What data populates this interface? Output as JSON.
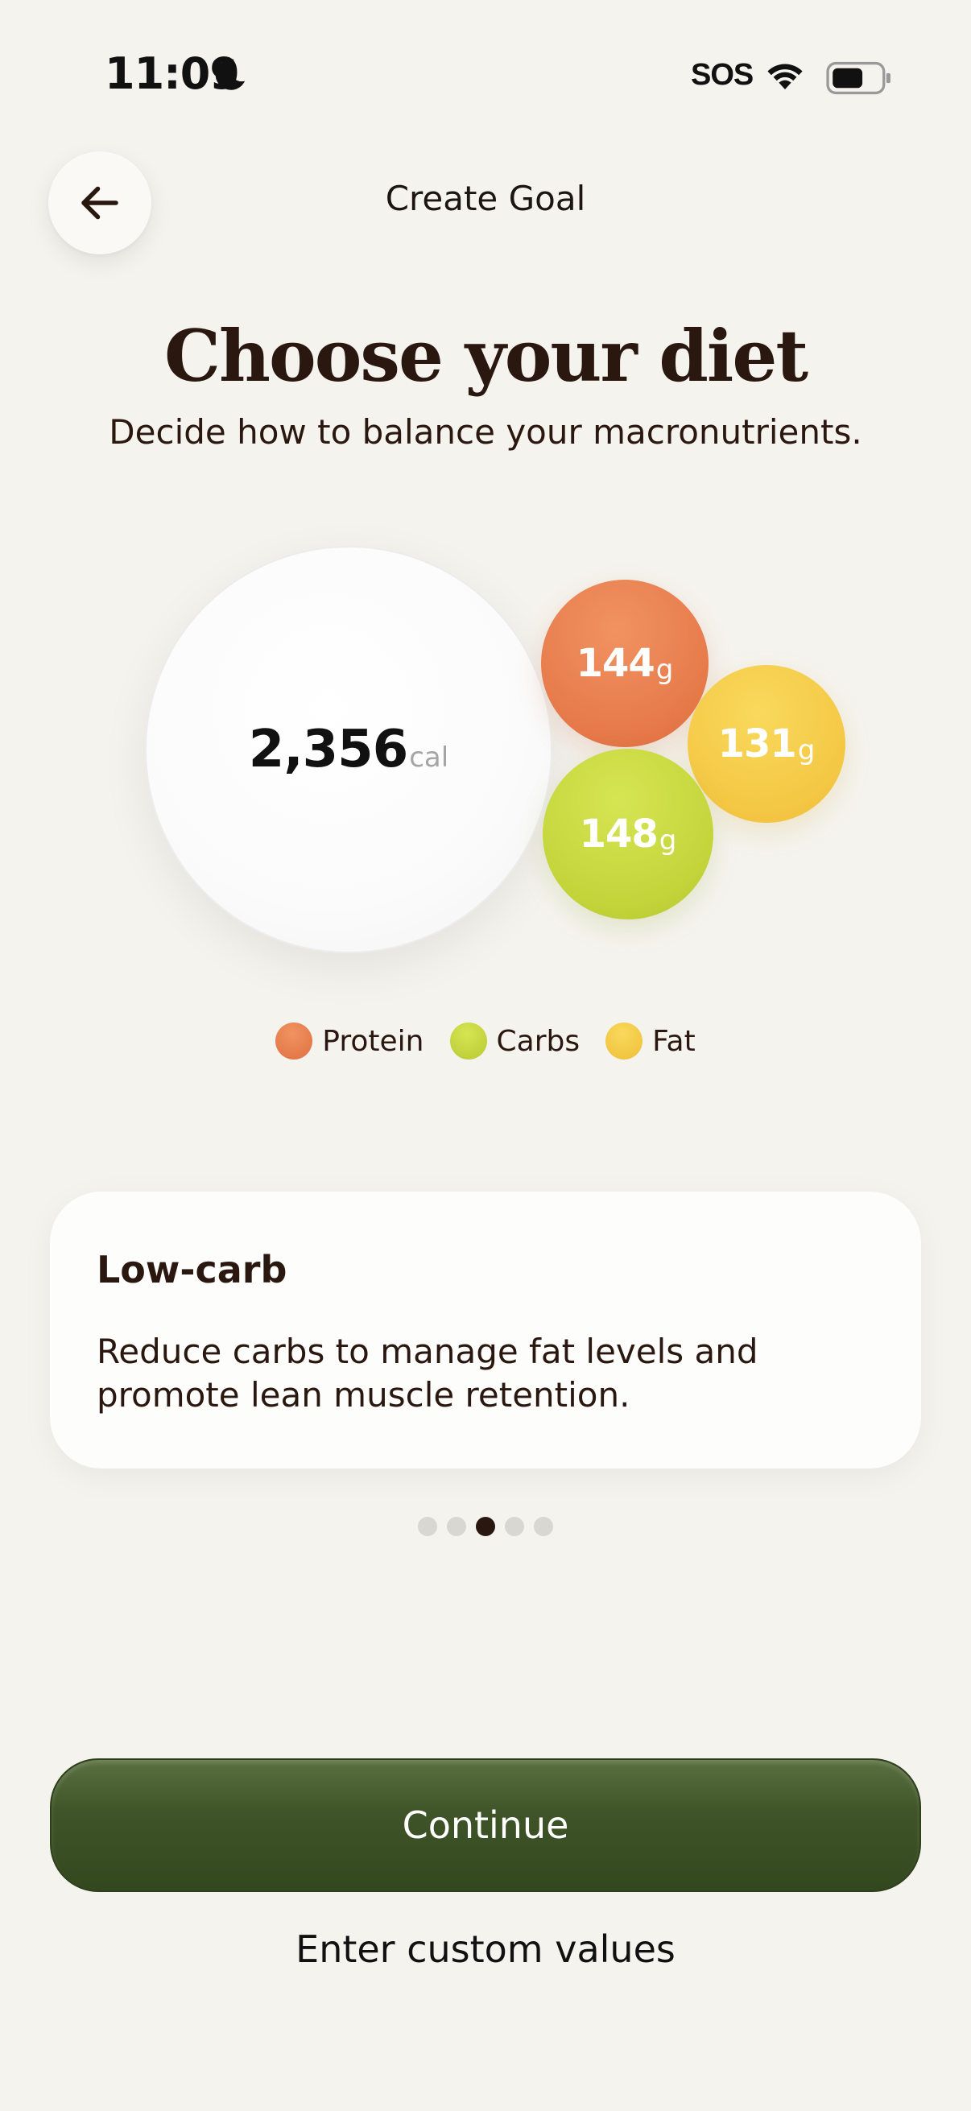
{
  "status_bar": {
    "time": "11:09",
    "sos": "SOS",
    "icons": [
      "moon-icon",
      "wifi-icon",
      "battery-icon"
    ]
  },
  "header": {
    "title": "Create Goal",
    "back_icon": "arrow-left-icon"
  },
  "main": {
    "title": "Choose your diet",
    "subtitle": "Decide how to balance your macronutrients."
  },
  "macros": {
    "calories": {
      "value": "2,356",
      "unit": "cal"
    },
    "protein": {
      "value": "144",
      "unit": "g",
      "color": "#e6794a"
    },
    "carbs": {
      "value": "148",
      "unit": "g",
      "color": "#c3d43a"
    },
    "fat": {
      "value": "131",
      "unit": "g",
      "color": "#f4c744"
    }
  },
  "legend": {
    "protein": "Protein",
    "carbs": "Carbs",
    "fat": "Fat"
  },
  "diet_card": {
    "title": "Low-carb",
    "description_line1": "Reduce carbs to manage fat levels and",
    "description_line2": "promote lean muscle retention."
  },
  "pager": {
    "count": 5,
    "active_index": 3
  },
  "actions": {
    "continue_label": "Continue",
    "custom_label": "Enter custom values"
  },
  "colors": {
    "background": "#f5f3ee",
    "primary_button": "#3f5428",
    "text": "#2a1810"
  }
}
